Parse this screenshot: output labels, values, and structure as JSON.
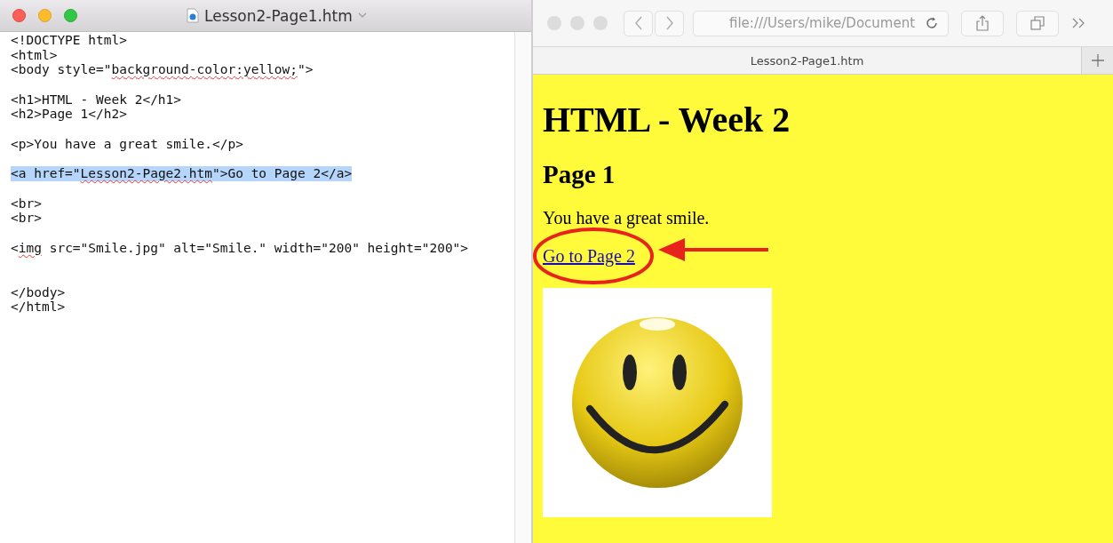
{
  "editor": {
    "title": "Lesson2-Page1.htm",
    "lines": [
      {
        "kind": "code",
        "selected": false,
        "parts": [
          {
            "text": "<!DOCTYPE html>"
          }
        ]
      },
      {
        "kind": "code",
        "selected": false,
        "parts": [
          {
            "text": "<html>"
          }
        ]
      },
      {
        "kind": "code",
        "selected": false,
        "parts": [
          {
            "text": "<body style=\""
          },
          {
            "text": "background-color:yellow;",
            "misspelled": true
          },
          {
            "text": "\">"
          }
        ]
      },
      {
        "kind": "blank"
      },
      {
        "kind": "code",
        "selected": false,
        "parts": [
          {
            "text": "<h1>HTML - Week 2</h1>"
          }
        ]
      },
      {
        "kind": "code",
        "selected": false,
        "parts": [
          {
            "text": "<h2>Page 1</h2>"
          }
        ]
      },
      {
        "kind": "blank"
      },
      {
        "kind": "code",
        "selected": false,
        "parts": [
          {
            "text": "<p>You have a great smile.</p>"
          }
        ]
      },
      {
        "kind": "blank"
      },
      {
        "kind": "code",
        "selected": true,
        "parts": [
          {
            "text": "<a href=\""
          },
          {
            "text": "Lesson2-Page2.htm",
            "misspelled": true
          },
          {
            "text": "\">Go to Page 2</a>"
          }
        ]
      },
      {
        "kind": "blank"
      },
      {
        "kind": "code",
        "selected": false,
        "parts": [
          {
            "text": "<br>"
          }
        ]
      },
      {
        "kind": "code",
        "selected": false,
        "parts": [
          {
            "text": "<br>"
          }
        ]
      },
      {
        "kind": "blank"
      },
      {
        "kind": "code",
        "selected": false,
        "parts": [
          {
            "text": "<"
          },
          {
            "text": "img",
            "misspelled": true
          },
          {
            "text": " src=\"Smile.jpg\" alt=\"Smile.\" width=\"200\" height=\"200\">"
          }
        ]
      },
      {
        "kind": "blank"
      },
      {
        "kind": "blank"
      },
      {
        "kind": "code",
        "selected": false,
        "parts": [
          {
            "text": "</body>"
          }
        ]
      },
      {
        "kind": "code",
        "selected": false,
        "parts": [
          {
            "text": "</html>"
          }
        ]
      }
    ]
  },
  "browser": {
    "address": "file:///Users/mike/Document",
    "tab": {
      "label": "Lesson2-Page1.htm",
      "selected": true
    },
    "page": {
      "heading": "HTML - Week 2",
      "subheading": "Page 1",
      "paragraph": "You have a great smile.",
      "link": "Go to Page 2"
    }
  }
}
